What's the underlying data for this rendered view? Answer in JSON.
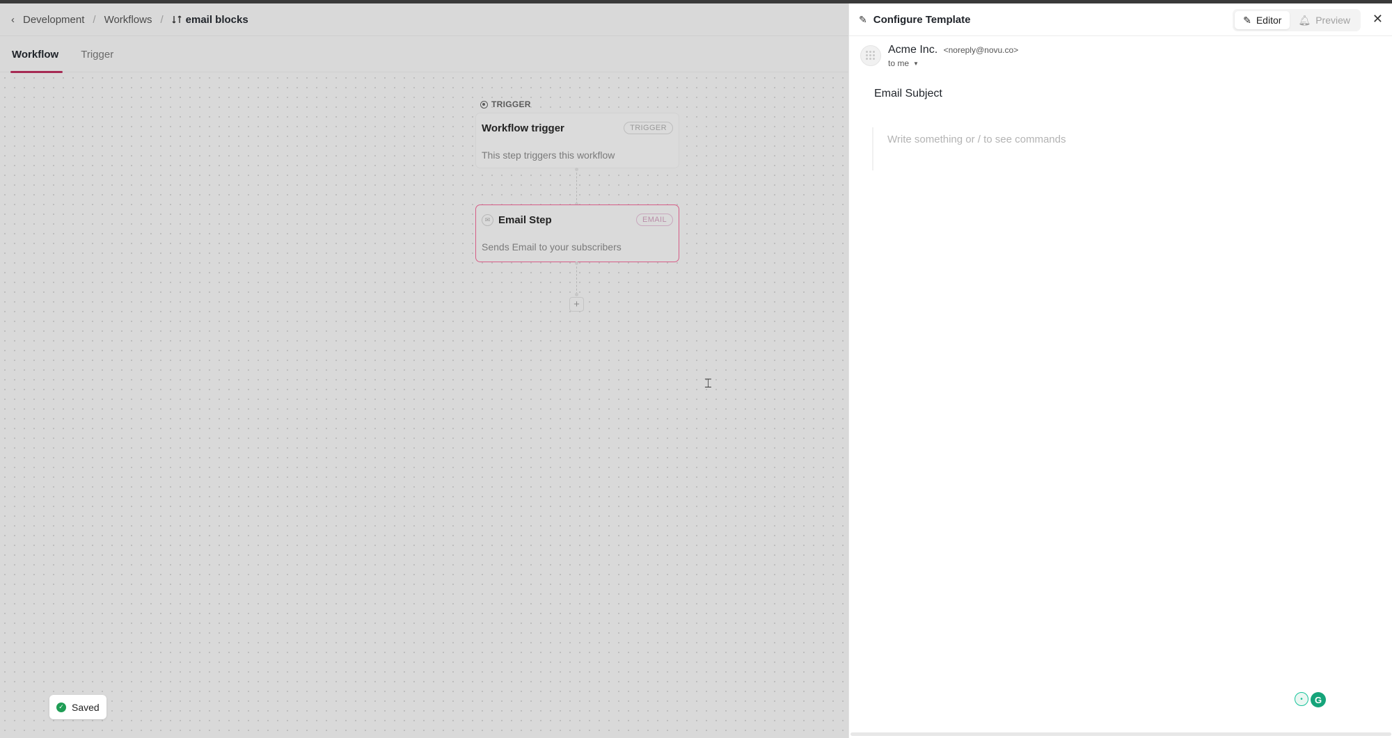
{
  "breadcrumb": {
    "items": [
      "Development",
      "Workflows"
    ],
    "current": "email blocks"
  },
  "tabs": [
    {
      "label": "Workflow",
      "active": true
    },
    {
      "label": "Trigger",
      "active": false
    }
  ],
  "workflow": {
    "section_label": "TRIGGER",
    "trigger_node": {
      "title": "Workflow trigger",
      "badge": "TRIGGER",
      "description": "This step triggers this workflow"
    },
    "email_node": {
      "title": "Email Step",
      "badge": "EMAIL",
      "description": "Sends Email to your subscribers"
    },
    "add_step_symbol": "+"
  },
  "toast": {
    "label": "Saved"
  },
  "panel": {
    "title": "Configure Template",
    "editor_label": "Editor",
    "preview_label": "Preview",
    "sender_name": "Acme Inc.",
    "sender_email": "<noreply@novu.co>",
    "recipient": "to me",
    "subject": "Email Subject",
    "editor_placeholder": "Write something or / to see commands"
  },
  "colors": {
    "accent": "#a62a53",
    "email_node_border": "#d65c86",
    "saved_check": "#1f9d55",
    "grammarly": "#15a47a"
  },
  "icons": [
    "chevron-left-icon",
    "workflow-icon",
    "pencil-icon",
    "editor-icon",
    "bell-icon",
    "close-icon",
    "check-icon",
    "grammarly-icon"
  ]
}
